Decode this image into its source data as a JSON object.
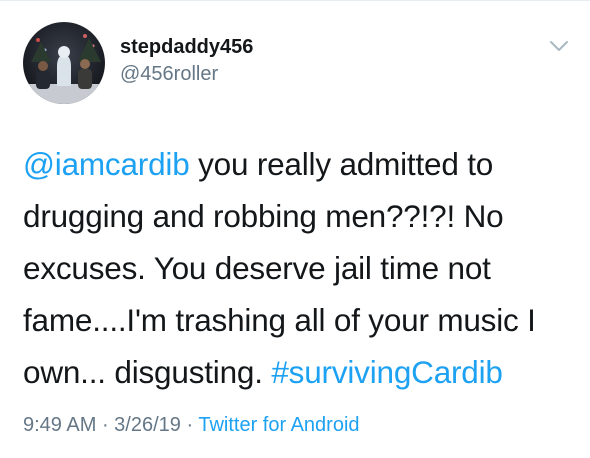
{
  "tweet": {
    "author": {
      "display_name": "stepdaddy456",
      "handle": "@456roller",
      "avatar_icon": "profile-photo-avatar"
    },
    "menu_icon": "chevron-down-icon",
    "text": {
      "mention": "@iamcardib",
      "line1_rest": " you really admitted to",
      "line2": "drugging and robbing men??!?! No",
      "line3": "excuses. You deserve jail time not",
      "line4": "fame....I'm trashing all of your music I",
      "line5_start": "own... disgusting. ",
      "hashtag": "#survivingCardib"
    },
    "meta": {
      "time": "9:49 AM",
      "separator1": " · ",
      "date": "3/26/19",
      "separator2": " · ",
      "source": "Twitter for Android"
    }
  },
  "colors": {
    "text": "#14171a",
    "secondary": "#657786",
    "link": "#1da1f2",
    "divider": "#e6ecf0"
  }
}
